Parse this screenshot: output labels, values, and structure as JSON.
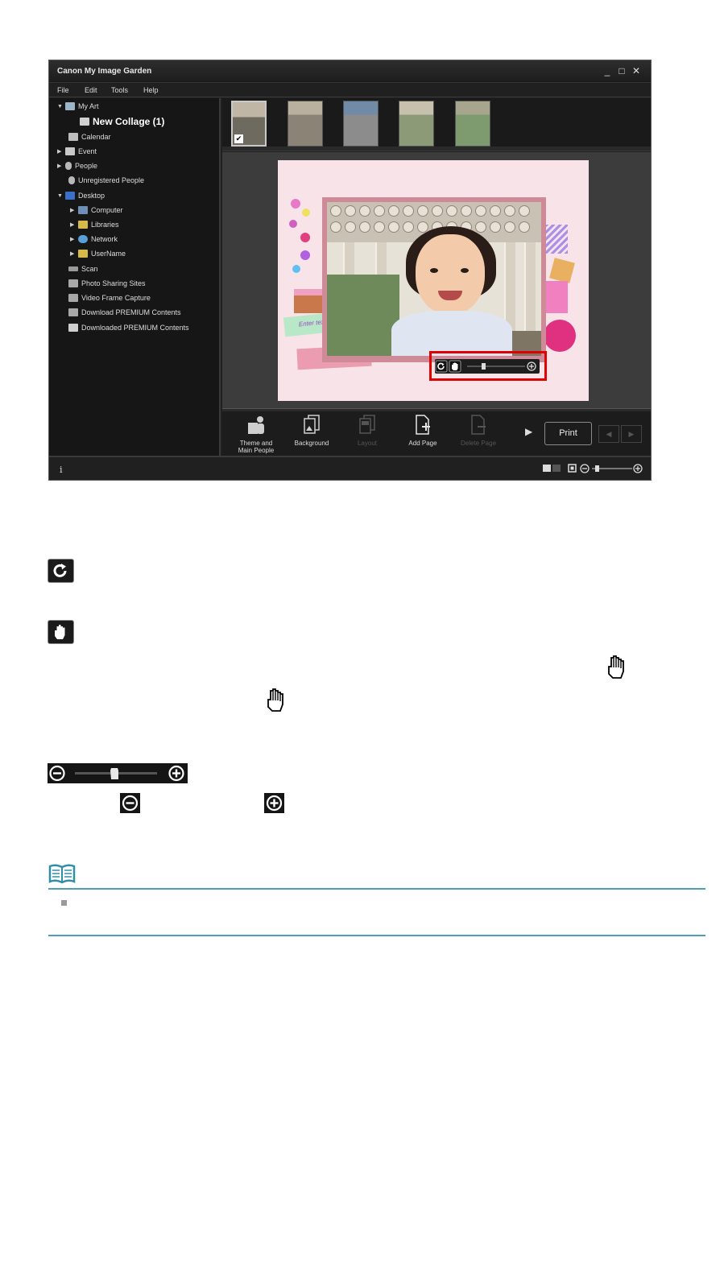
{
  "window": {
    "title": "Canon My Image Garden",
    "controls": [
      "minimize",
      "maximize",
      "close"
    ]
  },
  "menu": [
    "File",
    "Edit",
    "Tools",
    "Help"
  ],
  "sidebar": {
    "items": [
      {
        "label": "My Art",
        "icon": "my-art-icon",
        "arrow": "▼"
      },
      {
        "label": "New Collage (1)",
        "icon": "collage-icon",
        "arrow": ""
      },
      {
        "label": "Calendar",
        "icon": "calendar-icon",
        "arrow": ""
      },
      {
        "label": "Event",
        "icon": "event-icon",
        "arrow": "▶"
      },
      {
        "label": "People",
        "icon": "people-icon",
        "arrow": "▶"
      },
      {
        "label": "Unregistered People",
        "icon": "unregistered-people-icon",
        "arrow": ""
      },
      {
        "label": "Desktop",
        "icon": "desktop-icon",
        "arrow": "▼"
      },
      {
        "label": "Computer",
        "icon": "computer-icon",
        "arrow": "▶"
      },
      {
        "label": "Libraries",
        "icon": "libraries-icon",
        "arrow": "▶"
      },
      {
        "label": "Network",
        "icon": "network-icon",
        "arrow": "▶"
      },
      {
        "label": "UserName",
        "icon": "user-folder-icon",
        "arrow": "▶"
      },
      {
        "label": "Scan",
        "icon": "scan-icon",
        "arrow": ""
      },
      {
        "label": "Photo Sharing Sites",
        "icon": "photo-sharing-icon",
        "arrow": ""
      },
      {
        "label": "Video Frame Capture",
        "icon": "video-frame-icon",
        "arrow": ""
      },
      {
        "label": "Download PREMIUM Contents",
        "icon": "download-premium-icon",
        "arrow": ""
      },
      {
        "label": "Downloaded PREMIUM Contents",
        "icon": "downloaded-premium-icon",
        "arrow": ""
      }
    ]
  },
  "canvas": {
    "text_box_placeholder": "Enter tex"
  },
  "toolbar": {
    "buttons": [
      {
        "label": "Theme and Main People",
        "line1": "Theme and",
        "line2": "Main People",
        "enabled": true
      },
      {
        "label": "Background",
        "line1": "Background",
        "line2": "",
        "enabled": true
      },
      {
        "label": "Layout",
        "line1": "Layout",
        "line2": "",
        "enabled": false
      },
      {
        "label": "Add Page",
        "line1": "Add Page",
        "line2": "",
        "enabled": true
      },
      {
        "label": "Delete Page",
        "line1": "Delete Page",
        "line2": "",
        "enabled": false
      }
    ],
    "print_label": "Print"
  },
  "statusbar": {
    "info": "i"
  },
  "icons": {
    "rotate": "rotate-icon",
    "hand": "hand-icon",
    "zoom_slider": "zoom-slider",
    "zoom_out": "zoom-out-icon",
    "zoom_in": "zoom-in-icon",
    "note": "note-book-icon"
  }
}
